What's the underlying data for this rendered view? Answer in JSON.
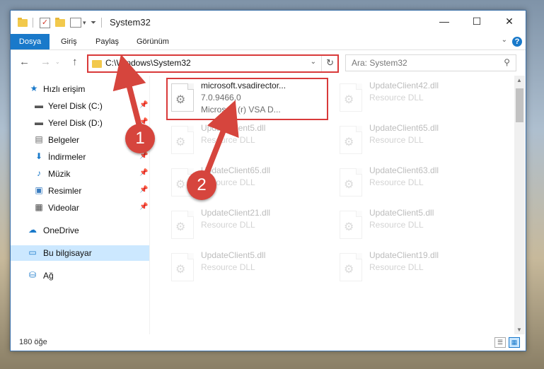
{
  "window": {
    "title": "System32",
    "controls": {
      "minimize": "—",
      "maximize": "☐",
      "close": "✕"
    }
  },
  "ribbon": {
    "tabs": [
      "Dosya",
      "Giriş",
      "Paylaş",
      "Görünüm"
    ],
    "help": "?"
  },
  "navigation": {
    "back": "←",
    "forward": "→",
    "up": "↑",
    "address": "C:\\Windows\\System32",
    "search_placeholder": "Ara: System32"
  },
  "sidebar": {
    "items": [
      {
        "label": "Hızlı erişim",
        "icon": "star-icon",
        "pinned": false
      },
      {
        "label": "Yerel Disk (C:)",
        "icon": "disk-icon",
        "pinned": true
      },
      {
        "label": "Yerel Disk (D:)",
        "icon": "disk-icon",
        "pinned": true
      },
      {
        "label": "Belgeler",
        "icon": "documents-icon",
        "pinned": true
      },
      {
        "label": "İndirmeler",
        "icon": "download-icon",
        "pinned": true
      },
      {
        "label": "Müzik",
        "icon": "music-icon",
        "pinned": true
      },
      {
        "label": "Resimler",
        "icon": "pictures-icon",
        "pinned": true
      },
      {
        "label": "Videolar",
        "icon": "videos-icon",
        "pinned": true
      },
      {
        "label": "OneDrive",
        "icon": "cloud-icon",
        "pinned": false
      },
      {
        "label": "Bu bilgisayar",
        "icon": "computer-icon",
        "pinned": false
      },
      {
        "label": "Ağ",
        "icon": "network-icon",
        "pinned": false
      }
    ]
  },
  "files": [
    {
      "name": "microsoft.vsadirector...",
      "line2": "7.0.9466.0",
      "line3": "Microsoft (r) VSA D...",
      "highlighted": true
    },
    {
      "name": "UpdateClient42.dll",
      "line2": "Resource DLL",
      "line3": ""
    },
    {
      "name": "UpdateClient5.dll",
      "line2": "Resource DLL",
      "line3": ""
    },
    {
      "name": "UpdateClient65.dll",
      "line2": "Resource DLL",
      "line3": ""
    },
    {
      "name": "UpdateClient65.dll",
      "line2": "Resource DLL",
      "line3": ""
    },
    {
      "name": "UpdateClient63.dll",
      "line2": "Resource DLL",
      "line3": ""
    },
    {
      "name": "UpdateClient21.dll",
      "line2": "Resource DLL",
      "line3": ""
    },
    {
      "name": "UpdateClient5.dll",
      "line2": "Resource DLL",
      "line3": ""
    },
    {
      "name": "UpdateClient5.dll",
      "line2": "Resource DLL",
      "line3": ""
    },
    {
      "name": "UpdateClient19.dll",
      "line2": "Resource DLL",
      "line3": ""
    }
  ],
  "status": {
    "count": "180 öğe"
  },
  "annotations": {
    "marker1": "1",
    "marker2": "2",
    "color": "#d6453d"
  },
  "colors": {
    "accent": "#1979ca",
    "highlight_border": "#d93a3a",
    "selected_bg": "#cce8ff"
  }
}
